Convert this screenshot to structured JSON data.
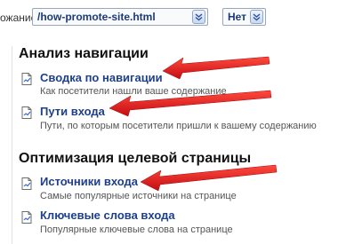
{
  "topbar": {
    "label_fragment": "ожание",
    "url_select": {
      "value": "/how-promote-site.html"
    },
    "ab_select": {
      "value": "Нет"
    }
  },
  "sections": [
    {
      "title": "Анализ навигации",
      "items": [
        {
          "link": "Сводка по навигации",
          "description": "Как посетители нашли ваше содержание",
          "icon": "report-page-icon"
        },
        {
          "link": "Пути входа",
          "description": "Пути, по которым посетители пришли к вашему содержанию",
          "icon": "report-page-icon"
        }
      ]
    },
    {
      "title": "Оптимизация целевой страницы",
      "items": [
        {
          "link": "Источники входа",
          "description": "Самые популярные источники на странице",
          "icon": "report-page-icon"
        },
        {
          "link": "Ключевые слова входа",
          "description": "Популярные ключевые слова на странице",
          "icon": "report-page-icon"
        }
      ]
    }
  ],
  "annotations": {
    "arrow_color": "#e8121a",
    "count": 3
  },
  "colors": {
    "link": "#1d3f8e",
    "description": "#555555",
    "select_text": "#1b3a78"
  }
}
